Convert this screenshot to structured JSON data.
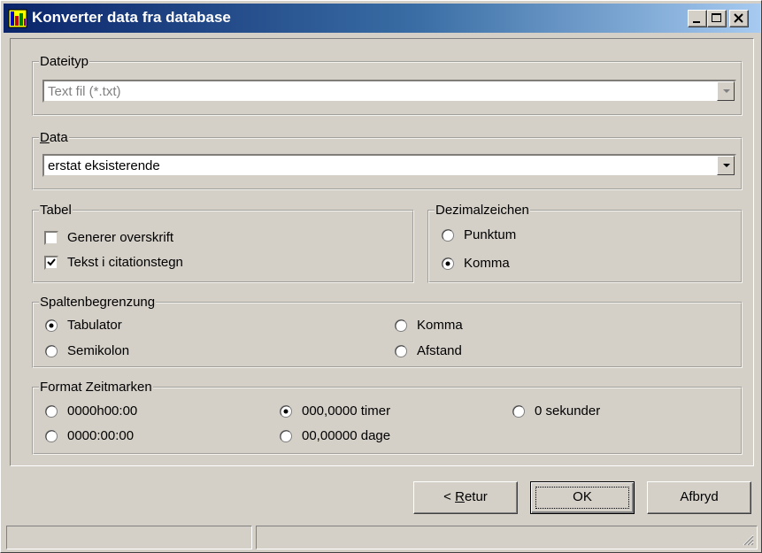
{
  "window": {
    "title": "Konverter data fra database"
  },
  "filetype": {
    "legend": "Dateityp",
    "value": "Text fil (*.txt)"
  },
  "data_group": {
    "legend": "Data",
    "value": "erstat eksisterende"
  },
  "table": {
    "legend": "Tabel",
    "generate_header": {
      "label": "Generer overskrift",
      "checked": false
    },
    "quoted_text": {
      "label": "Tekst i citationstegn",
      "checked": true
    }
  },
  "decimal": {
    "legend": "Dezimalzeichen",
    "options": [
      {
        "label": "Punktum",
        "selected": false
      },
      {
        "label": "Komma",
        "selected": true
      }
    ]
  },
  "delimiter": {
    "legend": "Spaltenbegrenzung",
    "options": [
      {
        "label": "Tabulator",
        "selected": true
      },
      {
        "label": "Semikolon",
        "selected": false
      },
      {
        "label": "Komma",
        "selected": false
      },
      {
        "label": "Afstand",
        "selected": false
      }
    ]
  },
  "time_format": {
    "legend": "Format Zeitmarken",
    "options": [
      {
        "label": "0000h00:00",
        "selected": false
      },
      {
        "label": "0000:00:00",
        "selected": false
      },
      {
        "label": "000,0000 timer",
        "selected": true
      },
      {
        "label": "00,00000 dage",
        "selected": false
      },
      {
        "label": "0 sekunder",
        "selected": false
      }
    ]
  },
  "buttons": {
    "back": "< Retur",
    "ok": "OK",
    "cancel": "Afbryd"
  },
  "status_bar": {
    "left": "",
    "right": ""
  }
}
